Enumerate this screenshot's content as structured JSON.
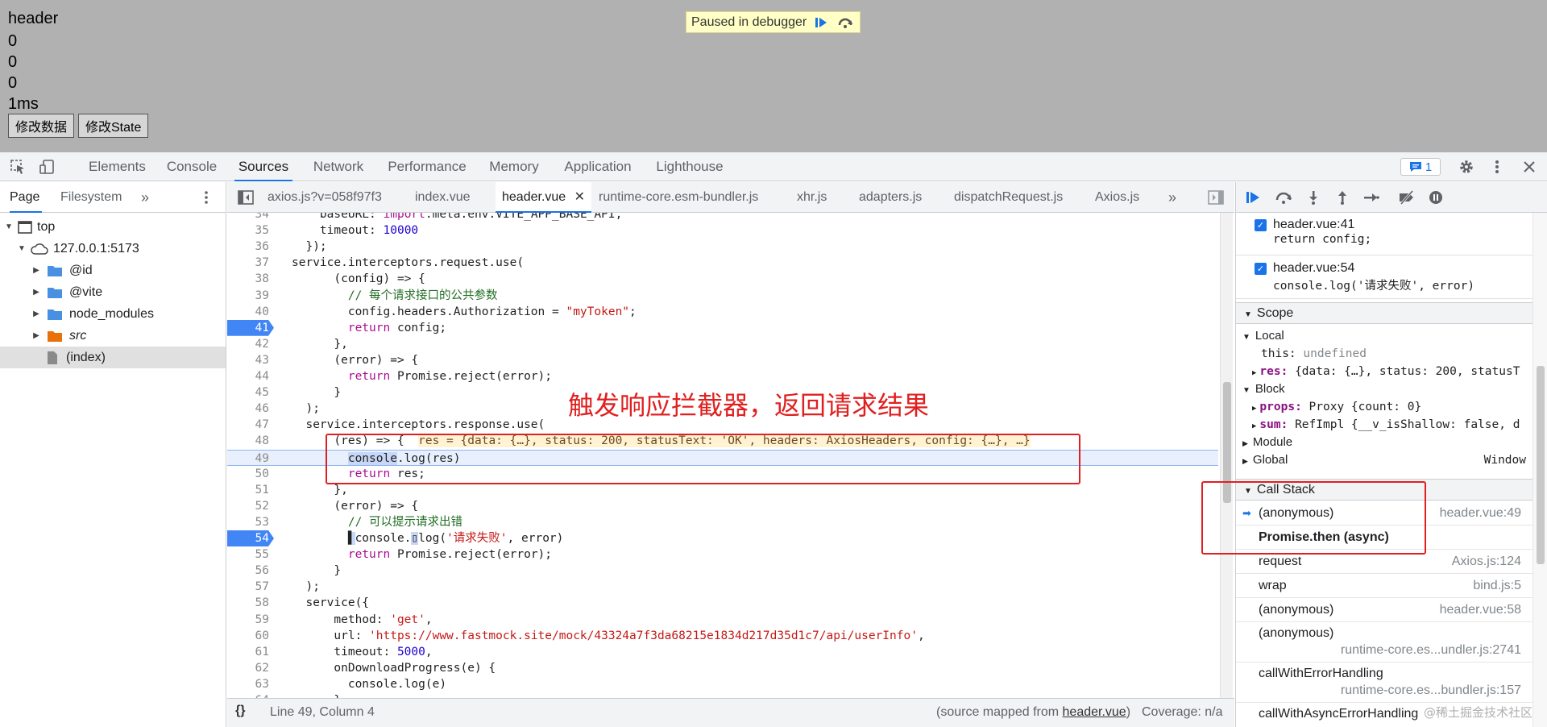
{
  "page": {
    "lines": [
      "header",
      "0",
      "0",
      "0",
      "1ms"
    ],
    "buttons": [
      "修改数据",
      "修改State"
    ],
    "paused_text": "Paused in debugger"
  },
  "devtools": {
    "tabs": [
      "Elements",
      "Console",
      "Sources",
      "Network",
      "Performance",
      "Memory",
      "Application",
      "Lighthouse"
    ],
    "active_tab": "Sources",
    "issues_count": "1"
  },
  "navigator": {
    "tabs": [
      "Page",
      "Filesystem"
    ],
    "tree": [
      {
        "label": "top",
        "kind": "frame"
      },
      {
        "label": "127.0.0.1:5173",
        "kind": "origin"
      },
      {
        "label": "@id",
        "kind": "folder"
      },
      {
        "label": "@vite",
        "kind": "folder"
      },
      {
        "label": "node_modules",
        "kind": "folder"
      },
      {
        "label": "src",
        "kind": "folder-src"
      },
      {
        "label": "(index)",
        "kind": "file"
      }
    ]
  },
  "editor": {
    "tabs": [
      "axios.js?v=058f97f3",
      "index.vue",
      "header.vue",
      "runtime-core.esm-bundler.js",
      "xhr.js",
      "adapters.js",
      "dispatchRequest.js",
      "Axios.js"
    ],
    "active_tab": "header.vue",
    "lines": [
      {
        "n": "34",
        "html": "    baseURL: <span class=\"kw\">import</span>.meta.env.VITE_APP_BASE_API,"
      },
      {
        "n": "35",
        "html": "    timeout: <span class=\"num\">10000</span>"
      },
      {
        "n": "36",
        "html": "  });"
      },
      {
        "n": "37",
        "html": "service.interceptors.request.use("
      },
      {
        "n": "38",
        "html": "      (config) => {"
      },
      {
        "n": "39",
        "html": "        <span class=\"cm\">// 每个请求接口的公共参数</span>"
      },
      {
        "n": "40",
        "html": "        config.headers.Authorization = <span class=\"str\">\"myToken\"</span>;"
      },
      {
        "n": "41",
        "html": "        <span class=\"kw\">return</span> config;",
        "bp": true
      },
      {
        "n": "42",
        "html": "      },"
      },
      {
        "n": "43",
        "html": "      (error) => {"
      },
      {
        "n": "44",
        "html": "        <span class=\"kw\">return</span> Promise.reject(error);"
      },
      {
        "n": "45",
        "html": "      }"
      },
      {
        "n": "46",
        "html": "  );"
      },
      {
        "n": "47",
        "html": "  service.interceptors.response.use("
      },
      {
        "n": "48",
        "html": "      (res) => {  <span class=\"inline-val\">res = {data: {…}, status: 200, statusText: 'OK', headers: AxiosHeaders, config: {…}, …}</span>"
      },
      {
        "n": "49",
        "html": "        <span class=\"sel\">console</span>.log(res)",
        "cur": true
      },
      {
        "n": "50",
        "html": "        <span class=\"kw\">return</span> res;"
      },
      {
        "n": "51",
        "html": "      },"
      },
      {
        "n": "52",
        "html": "      (error) => {"
      },
      {
        "n": "53",
        "html": "        <span class=\"cm\">// 可以提示请求出错</span>"
      },
      {
        "n": "54",
        "html": "        <span class=\"sel\">▌</span>console.<span class=\"sel\">▯</span>log(<span class=\"str\">'请求失败'</span>, error)",
        "bp": true
      },
      {
        "n": "55",
        "html": "        <span class=\"kw\">return</span> Promise.reject(error);"
      },
      {
        "n": "56",
        "html": "      }"
      },
      {
        "n": "57",
        "html": "  );"
      },
      {
        "n": "58",
        "html": "  service({"
      },
      {
        "n": "59",
        "html": "      method: <span class=\"str\">'get'</span>,"
      },
      {
        "n": "60",
        "html": "      url: <span class=\"str\">'https://www.fastmock.site/mock/43324a7f3da68215e1834d217d35d1c7/api/userInfo'</span>,"
      },
      {
        "n": "61",
        "html": "      timeout: <span class=\"num\">5000</span>,"
      },
      {
        "n": "62",
        "html": "      onDownloadProgress(e) {"
      },
      {
        "n": "63",
        "html": "        console.log(e)"
      },
      {
        "n": "64",
        "html": "      }"
      }
    ],
    "annotation": "触发响应拦截器，返回请求结果"
  },
  "statusbar": {
    "position": "Line 49, Column 4",
    "mapped_prefix": "(source mapped from ",
    "mapped_file": "header.vue",
    "mapped_suffix": ")",
    "coverage": "Coverage: n/a"
  },
  "breakpoints": [
    {
      "file": "header.vue:41",
      "code": "return config;"
    },
    {
      "file": "header.vue:54",
      "code": "console.log('请求失败', error)"
    }
  ],
  "scope": {
    "title": "Scope",
    "local_label": "Local",
    "this_label": "this:",
    "this_value": "undefined",
    "res_label": "res:",
    "res_value": "{data: {…}, status: 200, statusT",
    "block_label": "Block",
    "props_label": "props:",
    "props_value": "Proxy {count: 0}",
    "sum_label": "sum:",
    "sum_value": "RefImpl {__v_isShallow: false, d",
    "module_label": "Module",
    "global_label": "Global",
    "global_value": "Window"
  },
  "callstack": {
    "title": "Call Stack",
    "frames": [
      {
        "name": "(anonymous)",
        "loc": "header.vue:49"
      },
      {
        "name": "Promise.then (async)",
        "loc": ""
      },
      {
        "name": "request",
        "loc": "Axios.js:124"
      },
      {
        "name": "wrap",
        "loc": "bind.js:5"
      },
      {
        "name": "(anonymous)",
        "loc": "header.vue:58"
      },
      {
        "name": "(anonymous)",
        "loc": "runtime-core.es...undler.js:2741"
      },
      {
        "name": "callWithErrorHandling",
        "loc": "runtime-core.es...bundler.js:157"
      },
      {
        "name": "callWithAsyncErrorHandling",
        "loc": ""
      }
    ]
  },
  "watermark": "@稀土掘金技术社区",
  "colors": {
    "accent": "#1a73e8",
    "annotation": "#e02020",
    "paused_bg": "#ffffc6"
  }
}
